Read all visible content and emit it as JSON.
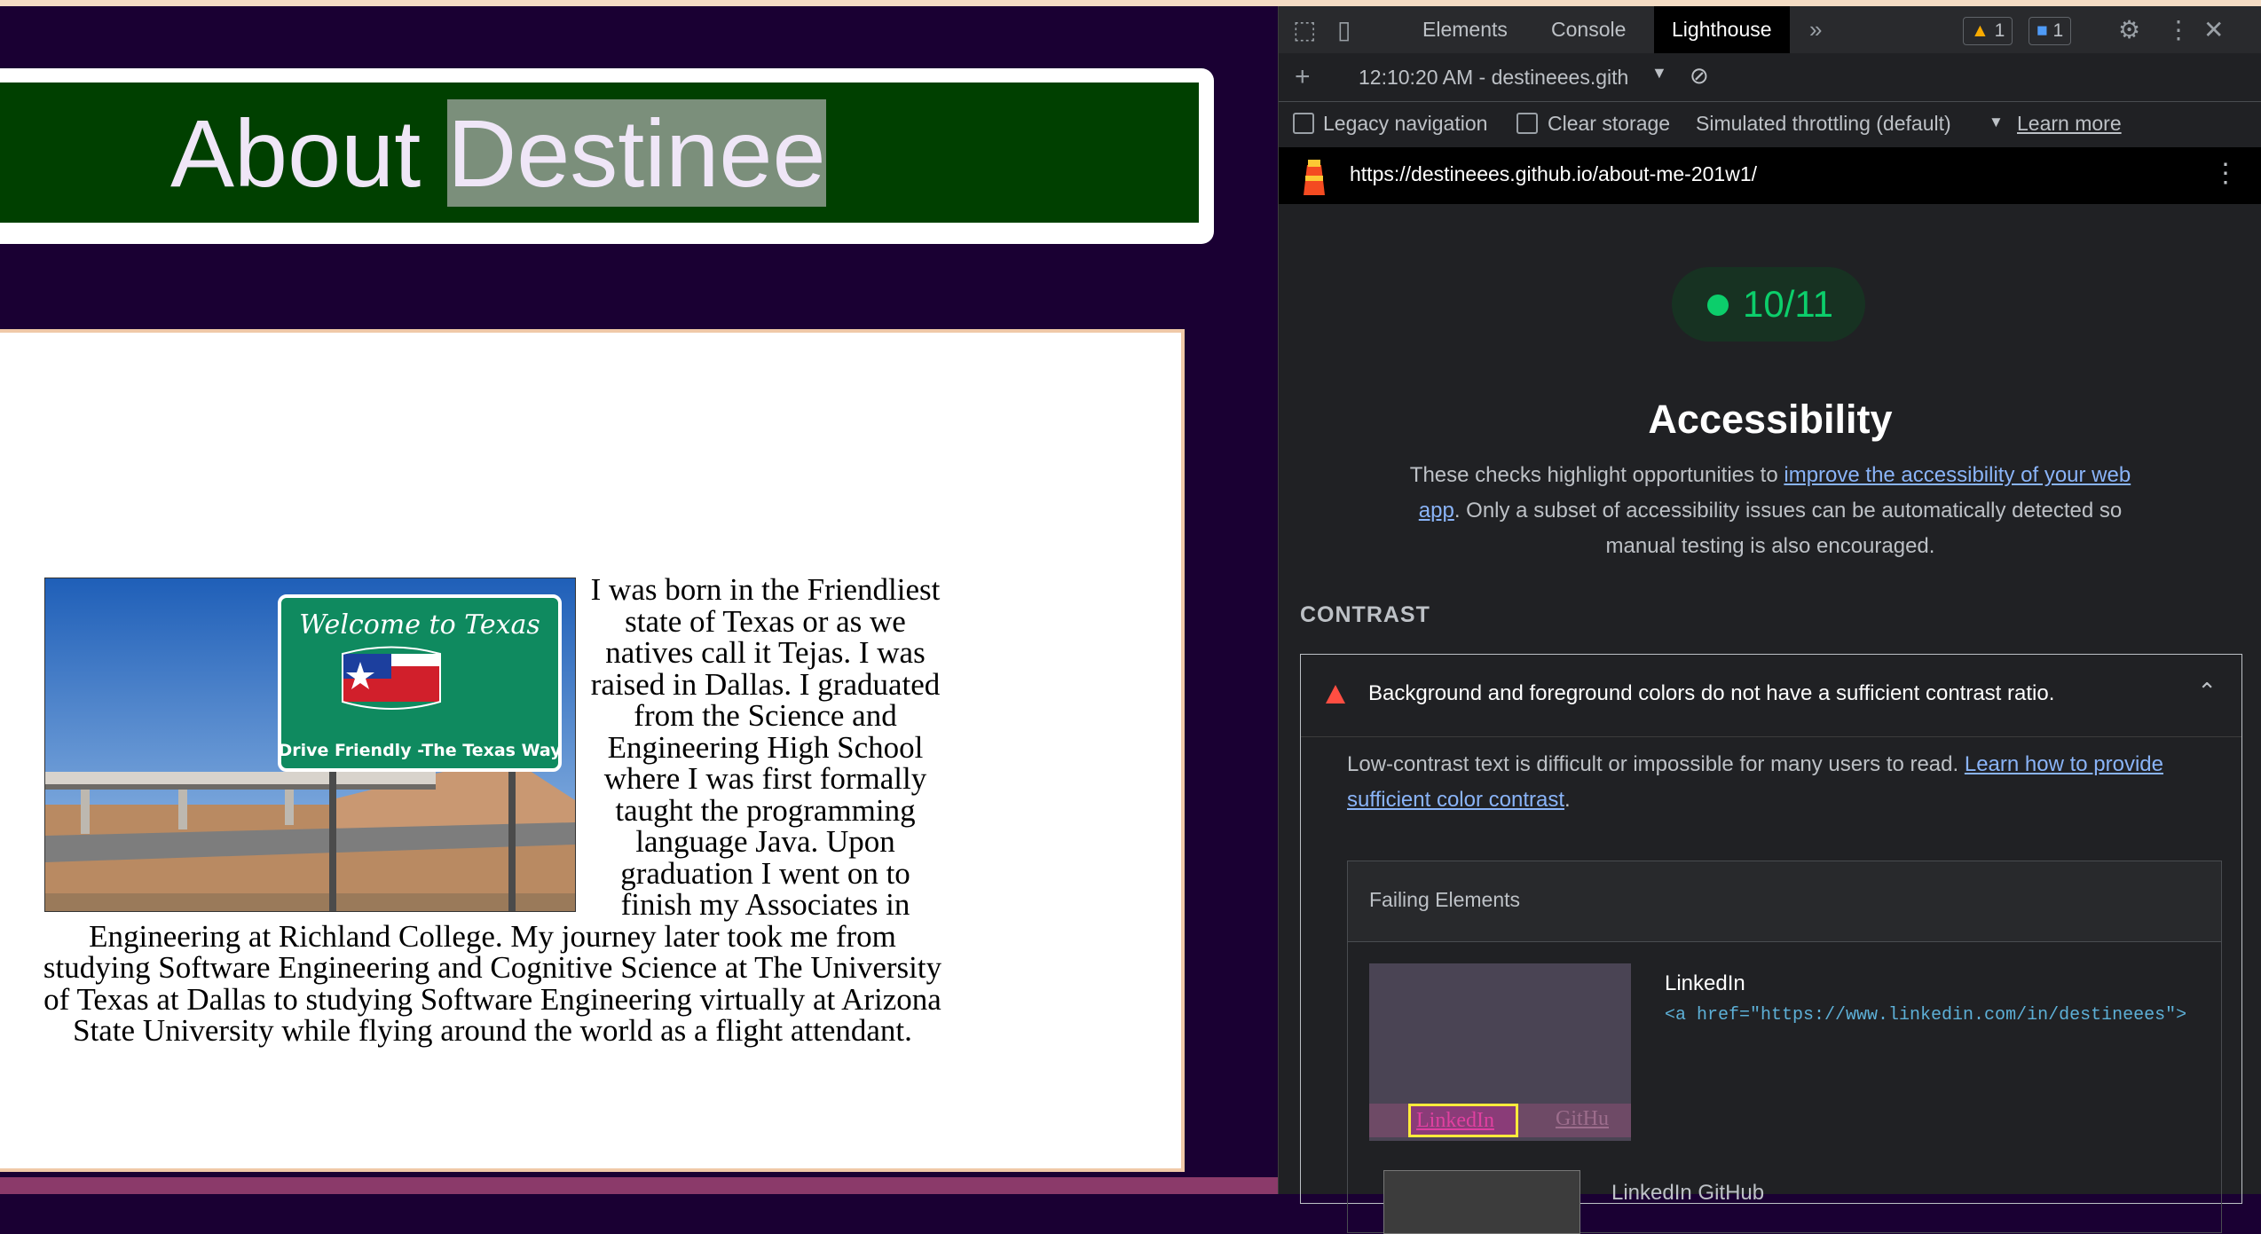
{
  "page": {
    "title_prefix": "About ",
    "title_highlight": "Destinee",
    "story": "I was born in the Friendliest state of Texas or as we natives call it Tejas. I was raised in Dallas. I graduated from the Science and Engineering High School where I was first formally taught the programming language Java. Upon graduation I went on to finish my Associates in Engineering at Richland College. My journey later took me from studying Software Engineering and Cognitive Science at The University of Texas at Dallas to studying Software Engineering virtually at Arizona State University while flying around the world as a flight attendant.",
    "photo": {
      "sign_line1": "Welcome to Texas",
      "sign_line2": "Drive Friendly  -The Texas Way"
    }
  },
  "devtools": {
    "tabs": [
      "Elements",
      "Console",
      "Lighthouse"
    ],
    "active_tab": "Lighthouse",
    "more_icon": "»",
    "warnings_count": "1",
    "messages_count": "1",
    "report_selector": "12:10:20 AM - destineees.gith",
    "options": {
      "legacy_navigation": "Legacy navigation",
      "clear_storage": "Clear storage",
      "throttling": "Simulated throttling (default)",
      "learn_more": "Learn more"
    },
    "url": "https://destineees.github.io/about-me-201w1/",
    "score": "10/11",
    "category_title": "Accessibility",
    "description": {
      "before": "These checks highlight opportunities to ",
      "link": "improve the accessibility of your web app",
      "after": ". Only a subset of accessibility issues can be automatically detected so manual testing is also encouraged."
    },
    "group_header": "CONTRAST",
    "audit": {
      "title": "Background and foreground colors do not have a sufficient contrast ratio.",
      "desc_before": "Low-contrast text is difficult or impossible for many users to read. ",
      "desc_link": "Learn how to provide sufficient color contrast",
      "desc_after": ".",
      "failing_header": "Failing Elements",
      "items": [
        {
          "label": "LinkedIn",
          "snippet": "<a href=\"https://www.linkedin.com/in/destineees\">",
          "thumb_text": "LinkedIn",
          "thumb_ghost": "GitHu"
        },
        {
          "label": "LinkedIn GitHub"
        }
      ]
    }
  },
  "colors": {
    "page_bg": "#1a0033",
    "title_bar": "#004000",
    "score_green": "#0cce6b",
    "devtools_bg": "#202124",
    "link_blue": "#8ab4f8",
    "fail_red": "#ff4e42"
  }
}
